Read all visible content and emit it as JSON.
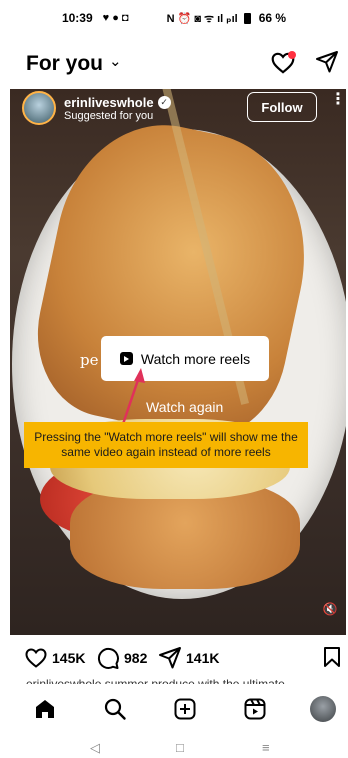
{
  "status_bar": {
    "time": "10:39",
    "left_icons": "♥ ● ◘",
    "right_icons": "N ⏰ ◙ ᯤ ıl ₚıl",
    "battery": "66 %"
  },
  "header": {
    "title": "For you",
    "dropdown_glyph": "⌄"
  },
  "reel": {
    "username": "erinliveswhole",
    "verified_glyph": "✓",
    "subtitle": "Suggested for you",
    "follow_label": "Follow",
    "more_glyph": "⋮",
    "ghost_text": "pe",
    "watch_more_label": "Watch more reels",
    "watch_again_label": "Watch again",
    "annotation": "Pressing the \"Watch more reels\" will show me the same video again instead of more reels",
    "mute_glyph": "🔇"
  },
  "actions": {
    "likes": "145K",
    "comments": "982",
    "shares": "141K",
    "caption": "erinliveswhole summer produce with the ultimate"
  },
  "system_nav": {
    "back": "◁",
    "home": "□",
    "recent": "≡"
  },
  "colors": {
    "annotation_bg": "#f7b500",
    "arrow": "#e0315a",
    "notification_dot": "#ff3040"
  },
  "icons": {
    "heart": "heart-icon",
    "send": "send-icon",
    "comment": "comment-icon",
    "share": "share-icon",
    "save": "bookmark-icon",
    "home": "home-icon",
    "search": "search-icon",
    "create": "plus-square-icon",
    "reels": "reels-icon",
    "mute": "mute-icon"
  }
}
